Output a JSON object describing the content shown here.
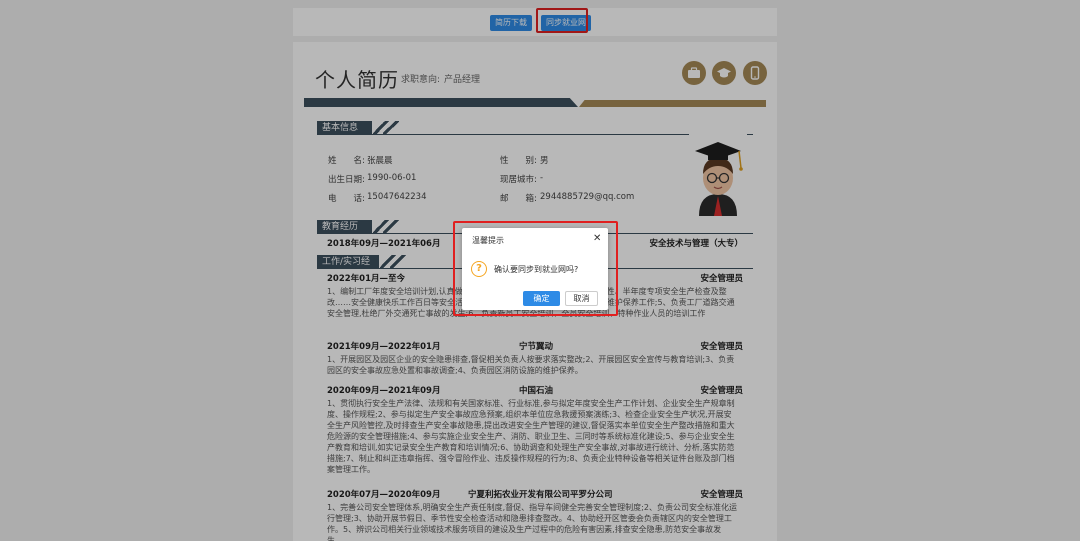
{
  "toolbar": {
    "download_label": "简历下载",
    "sync_label": "同步就业网"
  },
  "resume": {
    "title": "个人简历",
    "intent_label": "求职意向:",
    "intent_value": "产品经理",
    "icons": [
      "briefcase-icon",
      "graduation-cap-icon",
      "phone-icon"
    ]
  },
  "basic": {
    "section_label": "基本信息",
    "name_label": "姓　　名:",
    "name_value": "张晨晨",
    "gender_label": "性　　别:",
    "gender_value": "男",
    "birth_label": "出生日期:",
    "birth_value": "1990-06-01",
    "city_label": "现居城市:",
    "city_value": "-",
    "phone_label": "电　　话:",
    "phone_value": "15047642234",
    "email_label": "邮　　箱:",
    "email_value": "2944885729@qq.com"
  },
  "education": {
    "section_label": "教育经历",
    "date": "2018年09月—2021年06月",
    "major": "安全技术与管理（大专）"
  },
  "work": {
    "section_label": "工作/实习经历",
    "items": [
      {
        "date": "2022年01月—至今",
        "org": "",
        "role": "安全管理员",
        "desc": "1、编制工厂年度安全培训计划,认真做好……月度综合性、季度、节假日、专业性、半年度专项安全生产检查及整改……安全健康快乐工作百日等安全活动;4、负责全厂安全设施、防护器材……维护保养工作;5、负责工厂道路交通安全管理,杜绝厂外交通死亡事故的发生;6、负责新员工安全培训、全员安全培训、特种作业人员的培训工作"
      },
      {
        "date": "2021年09月—2022年01月",
        "org": "宁节翼动",
        "role": "安全管理员",
        "desc": "1、开展园区及园区企业的安全隐患排查,督促相关负责人按要求落实整改;2、开展园区安全宣传与教育培训;3、负责园区的安全事故应急处置和事故调查;4、负责园区消防设施的维护保养。"
      },
      {
        "date": "2020年09月—2021年09月",
        "org": "中国石油",
        "role": "安全管理员",
        "desc": "1、贯彻执行安全生产法律、法规和有关国家标准、行业标准,参与拟定年度安全生产工作计划、企业安全生产规章制度、操作规程;2、参与拟定生产安全事故应急预案,组织本单位应急救援预案演练;3、检查企业安全生产状况,开展安全生产风险管控,及时排查生产安全事故隐患,提出改进安全生产管理的建议,督促落实本单位安全生产整改措施和重大危险源的安全管理措施;4、参与实施企业安全生产、消防、职业卫生、三同时等系统标准化建设;5、参与企业安全生产教育和培训,如实记录安全生产教育和培训情况;6、协助调查和处理生产安全事故,对事故进行统计、分析,落实防范措施;7、制止和纠正违章指挥、强令冒险作业、违反操作规程的行为;8、负责企业特种设备等相关证件台账及部门档案管理工作。"
      },
      {
        "date": "2020年07月—2020年09月",
        "org": "宁夏利拓农业开发有限公司平罗分公司",
        "role": "安全管理员",
        "desc": "1、完善公司安全管理体系,明确安全生产责任制度,督促、指导车间健全完善安全管理制度;2、负责公司安全标准化运行管理;3、协助开展节假日、季节性安全检查活动和隐患排查整改。4、协助经开区管委会负责辖区内的安全管理工作。5、辨识公司相关行业领域技术服务项目的建设及生产过程中的危险有害因素,排查安全隐患,防范安全事故发生。"
      }
    ]
  },
  "dialog": {
    "title": "温馨提示",
    "message": "确认要同步到就业网吗?",
    "ok_label": "确定",
    "cancel_label": "取消"
  },
  "colors": {
    "primary": "#2e8be6",
    "dark_band": "#3c4f5d",
    "gold": "#a58a57",
    "highlight": "#e02020",
    "warning": "#f5a623"
  }
}
